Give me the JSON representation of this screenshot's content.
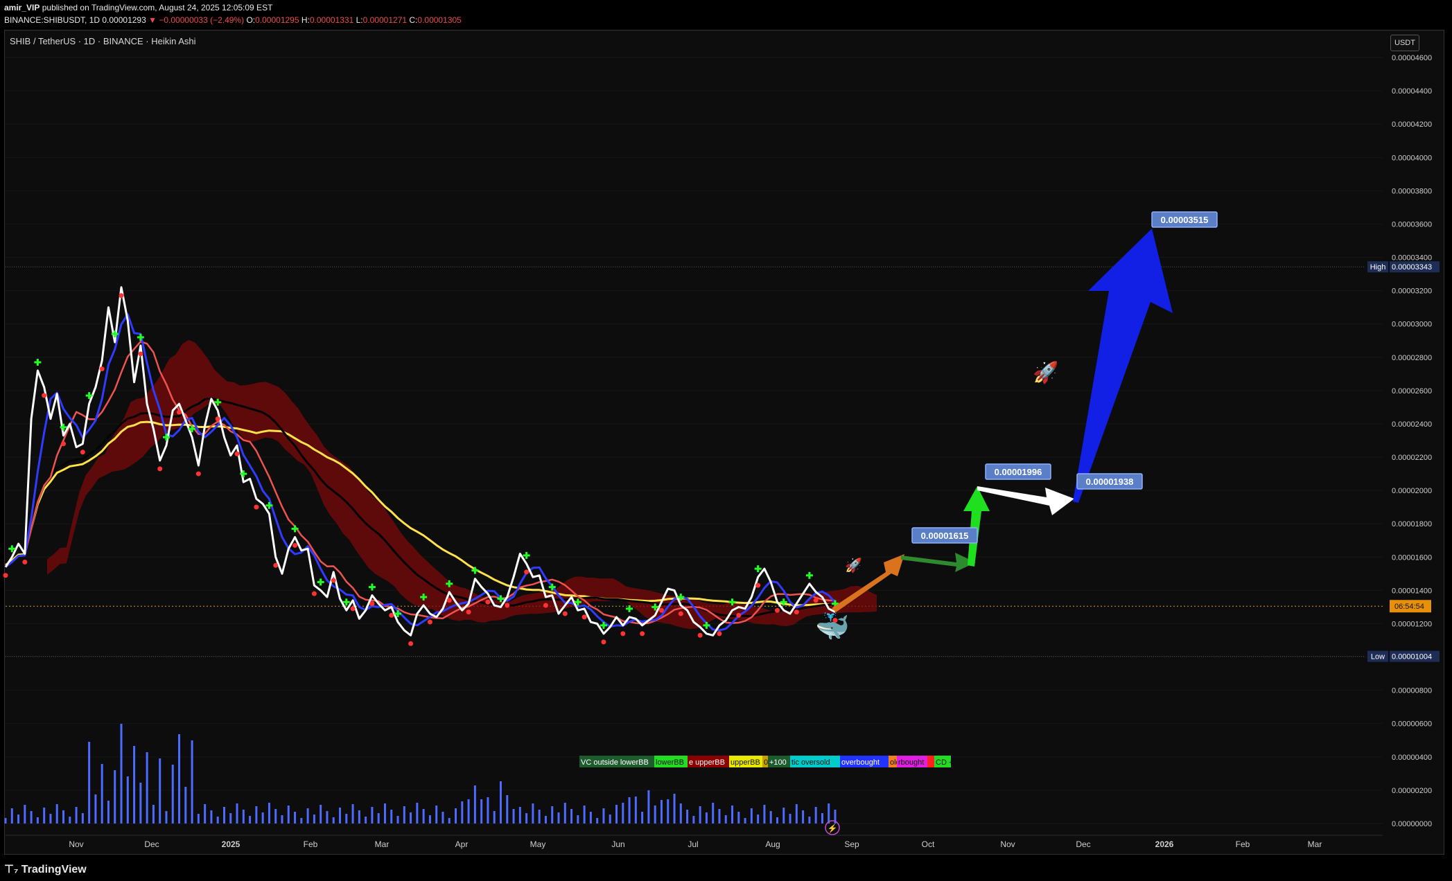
{
  "header": {
    "publisher": "amir_VIP",
    "published_text": "published on TradingView.com, August 24, 2025 12:05:09 EST",
    "symbol_line_prefix": "BINANCE:SHIBUSDT, 1D",
    "last": "0.00001293",
    "change": "▼ −0.00000033 (−2.49%)",
    "o_label": "O:",
    "o_value": "0.00001295",
    "h_label": "H:",
    "h_value": "0.00001331",
    "l_label": "L:",
    "l_value": "0.00001271",
    "c_label": "C:",
    "c_value": "0.00001305"
  },
  "chart_title": "SHIB / TetherUS · 1D · BINANCE · Heikin Ashi",
  "currency_button": "USDT",
  "footer_logo": "TradingView",
  "colors": {
    "background": "#0d0d0d",
    "price_line": "#ffffff",
    "ema_red": "#ef5350",
    "ema_blue": "#2f3cff",
    "ma_yellow": "#ffe14a",
    "ma_black": "#050505",
    "cloud_red": "#7a0a0a",
    "cloud_green": "#1f5c1f",
    "volume": "#4f6bff",
    "arrow_orange": "#d9731e",
    "arrow_green1": "#2e8a2e",
    "arrow_green2": "#1fe01f",
    "arrow_white": "#ffffff",
    "arrow_blue": "#1220e6",
    "label_bg": "#5b7fc7"
  },
  "icons": [
    "rocket-icon",
    "whale-icon",
    "lightning-icon"
  ],
  "chart_data": {
    "type": "line",
    "title": "SHIB / TetherUS · 1D · BINANCE · Heikin Ashi",
    "y_ticks": [
      "0.00004600",
      "0.00004400",
      "0.00004200",
      "0.00004000",
      "0.00003800",
      "0.00003600",
      "0.00003400",
      "0.00003200",
      "0.00003000",
      "0.00002800",
      "0.00002600",
      "0.00002400",
      "0.00002200",
      "0.00002000",
      "0.00001800",
      "0.00001600",
      "0.00001400",
      "0.00001200",
      "0.00001000",
      "0.00000800",
      "0.00000600",
      "0.00000400",
      "0.00000200",
      "0.00000000"
    ],
    "ylim": [
      0,
      4.7e-05
    ],
    "x_ticks": [
      "Nov",
      "Dec",
      "2025",
      "Feb",
      "Mar",
      "Apr",
      "May",
      "Jun",
      "Jul",
      "Aug",
      "Sep",
      "Oct",
      "Nov",
      "Dec",
      "2026",
      "Feb",
      "Mar"
    ],
    "high": {
      "label": "High",
      "value": "0.00003343"
    },
    "low": {
      "label": "Low",
      "value": "0.00001004"
    },
    "countdown": "06:54:54",
    "current_price": 1.305e-05,
    "targets": [
      "0.00001615",
      "0.00001996",
      "0.00001938",
      "0.00003515"
    ],
    "indicator_labels": [
      "VC outside lowerBB",
      "lowerBB",
      "e upperBB",
      "upperBB",
      "0",
      "+100",
      "tic oversold",
      "overbought",
      "old",
      "rbought",
      "",
      "CD +"
    ],
    "series": [
      {
        "values": [
          1.54e-05,
          1.6e-05,
          1.68e-05,
          1.62e-05,
          2.43e-05,
          2.72e-05,
          2.62e-05,
          2.43e-05,
          2.58e-05,
          2.33e-05,
          2.4e-05,
          2.26e-05,
          2.28e-05,
          2.52e-05,
          2.62e-05,
          2.78e-05,
          3.1e-05,
          2.89e-05,
          3.22e-05,
          3.02e-05,
          2.65e-05,
          2.87e-05,
          2.52e-05,
          2.37e-05,
          2.18e-05,
          2.27e-05,
          2.48e-05,
          2.52e-05,
          2.42e-05,
          2.32e-05,
          2.15e-05,
          2.39e-05,
          2.55e-05,
          2.48e-05,
          2.32e-05,
          2.21e-05,
          2.27e-05,
          2.05e-05,
          2.07e-05,
          1.95e-05,
          1.92e-05,
          1.86e-05,
          1.6e-05,
          1.5e-05,
          1.65e-05,
          1.72e-05,
          1.64e-05,
          1.65e-05,
          1.43e-05,
          1.4e-05,
          1.36e-05,
          1.51e-05,
          1.35e-05,
          1.28e-05,
          1.34e-05,
          1.23e-05,
          1.28e-05,
          1.37e-05,
          1.32e-05,
          1.28e-05,
          1.3e-05,
          1.21e-05,
          1.16e-05,
          1.13e-05,
          1.26e-05,
          1.31e-05,
          1.26e-05,
          1.24e-05,
          1.29e-05,
          1.39e-05,
          1.33e-05,
          1.28e-05,
          1.32e-05,
          1.47e-05,
          1.42e-05,
          1.38e-05,
          1.31e-05,
          1.3e-05,
          1.36e-05,
          1.48e-05,
          1.62e-05,
          1.56e-05,
          1.48e-05,
          1.49e-05,
          1.36e-05,
          1.37e-05,
          1.26e-05,
          1.31e-05,
          1.36e-05,
          1.28e-05,
          1.29e-05,
          1.21e-05,
          1.2e-05,
          1.14e-05,
          1.18e-05,
          1.24e-05,
          1.19e-05,
          1.24e-05,
          1.23e-05,
          1.19e-05,
          1.22e-05,
          1.25e-05,
          1.33e-05,
          1.41e-05,
          1.4e-05,
          1.31e-05,
          1.28e-05,
          1.21e-05,
          1.18e-05,
          1.14e-05,
          1.13e-05,
          1.19e-05,
          1.22e-05,
          1.28e-05,
          1.3e-05,
          1.29e-05,
          1.36e-05,
          1.48e-05,
          1.53e-05,
          1.45e-05,
          1.33e-05,
          1.28e-05,
          1.26e-05,
          1.32e-05,
          1.38e-05,
          1.44e-05,
          1.39e-05,
          1.36e-05,
          1.29e-05,
          1.27e-05
        ]
      }
    ]
  }
}
